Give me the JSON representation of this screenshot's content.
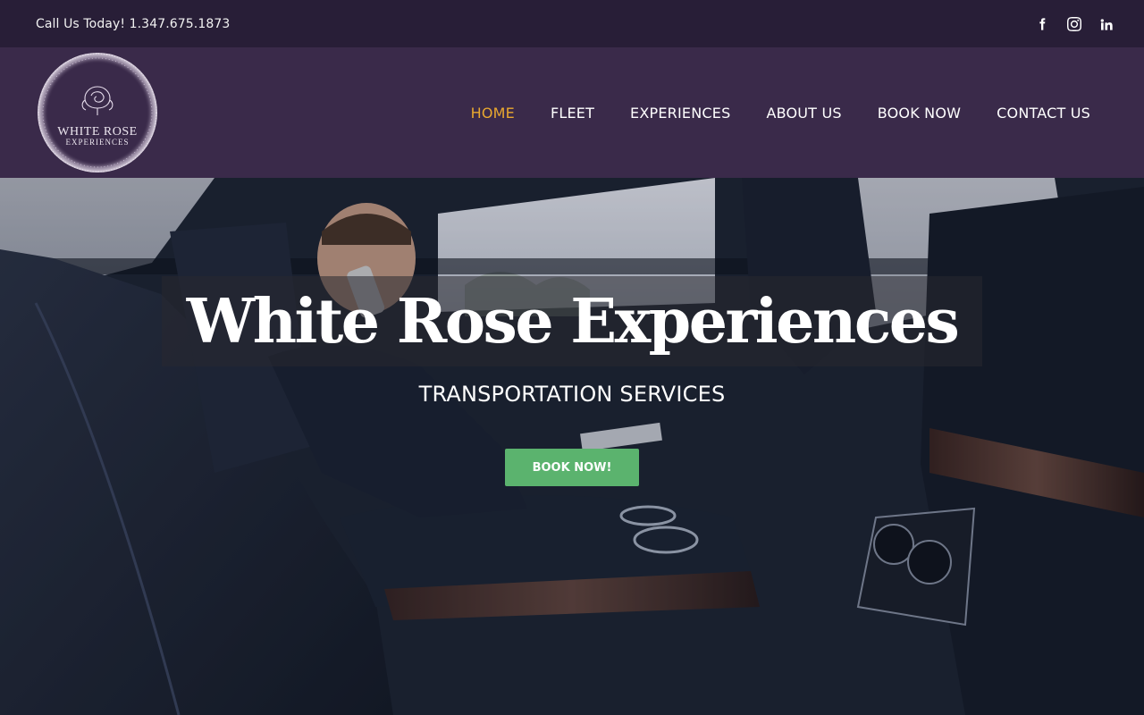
{
  "topbar": {
    "phone": "Call Us Today! 1.347.675.1873",
    "social": [
      {
        "name": "facebook-icon"
      },
      {
        "name": "instagram-icon"
      },
      {
        "name": "linkedin-icon"
      }
    ]
  },
  "logo": {
    "line1": "WHITE ROSE",
    "line2": "EXPERIENCES"
  },
  "nav": {
    "items": [
      "HOME",
      "FLEET",
      "EXPERIENCES",
      "ABOUT US",
      "BOOK NOW",
      "CONTACT US"
    ],
    "active": "HOME"
  },
  "hero": {
    "title": "White Rose Experiences",
    "subtitle": "TRANSPORTATION SERVICES",
    "cta": "BOOK NOW!"
  },
  "colors": {
    "topbar": "#281e37",
    "header": "#3a2a4a",
    "nav_active": "#e9a82f",
    "cta": "#5bb36e"
  }
}
